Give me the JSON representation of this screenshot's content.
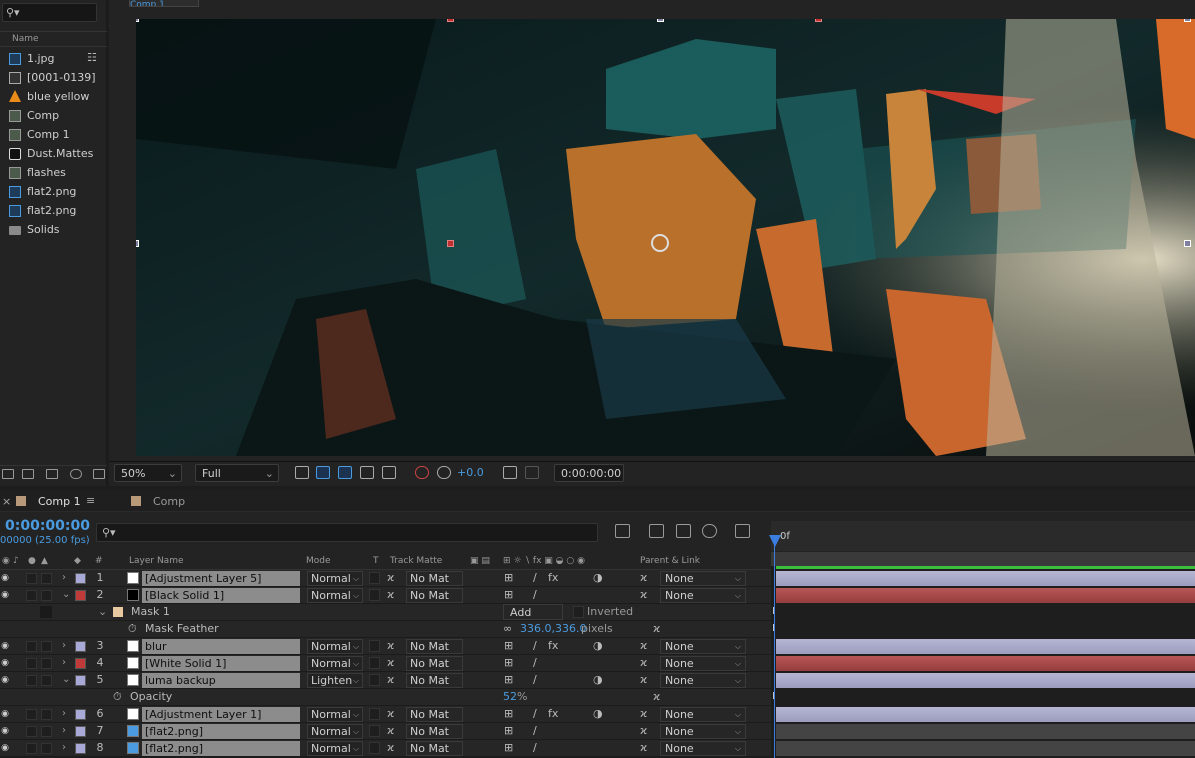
{
  "project": {
    "name_header": "Name",
    "items": [
      {
        "label": "1.jpg",
        "icon": "image-icon"
      },
      {
        "label": "[0001-0139]",
        "icon": "sequence-icon"
      },
      {
        "label": "blue yellow",
        "icon": "vlc-cone-icon"
      },
      {
        "label": "Comp",
        "icon": "composition-icon"
      },
      {
        "label": "Comp 1",
        "icon": "composition-icon"
      },
      {
        "label": "Dust.Mattes",
        "icon": "dust-icon"
      },
      {
        "label": "flashes",
        "icon": "composition-icon"
      },
      {
        "label": "flat2.png",
        "icon": "image-icon"
      },
      {
        "label": "flat2.png",
        "icon": "image-icon"
      },
      {
        "label": "Solids",
        "icon": "folder-icon"
      }
    ]
  },
  "viewer": {
    "top_tab": "Comp 1",
    "zoom": "50%",
    "resolution": "Full",
    "exposure": "+0.0",
    "timecode": "0:00:00:00"
  },
  "timeline": {
    "tabs": [
      {
        "label": "Comp 1",
        "active": true
      },
      {
        "label": "Comp",
        "active": false
      }
    ],
    "current_time": "0:00:00:00",
    "fps": "00000 (25.00 fps)",
    "ruler_label": "0f",
    "columns": {
      "number": "#",
      "layer_name": "Layer Name",
      "mode": "Mode",
      "t": "T",
      "track_matte": "Track Matte",
      "parent": "Parent & Link"
    },
    "rows": [
      {
        "kind": "layer",
        "num": "1",
        "name": "[Adjustment Layer 5]",
        "mode": "Normal",
        "matte": "No Mat",
        "parent": "None",
        "label_color": "#a9a9d8",
        "thumb": "#ffffff",
        "fx": true,
        "adj": true,
        "bar": "purple"
      },
      {
        "kind": "layer",
        "num": "2",
        "name": "[Black Solid 1]",
        "mode": "Normal",
        "matte": "No Mat",
        "parent": "None",
        "label_color": "#c03a3a",
        "thumb": "#000000",
        "fx": false,
        "adj": false,
        "bar": "red",
        "expanded": true
      },
      {
        "kind": "mask",
        "name": "Mask 1",
        "mode": "Add",
        "inverted": "Inverted"
      },
      {
        "kind": "prop",
        "name": "Mask Feather",
        "value": "336.0,336.0",
        "unit": "pixels"
      },
      {
        "kind": "layer",
        "num": "3",
        "name": "blur",
        "mode": "Normal",
        "matte": "No Mat",
        "parent": "None",
        "label_color": "#a9a9d8",
        "thumb": "#ffffff",
        "fx": true,
        "adj": true,
        "bar": "purple"
      },
      {
        "kind": "layer",
        "num": "4",
        "name": "[White Solid 1]",
        "mode": "Normal",
        "matte": "No Mat",
        "parent": "None",
        "label_color": "#c03a3a",
        "thumb": "#ffffff",
        "fx": false,
        "adj": false,
        "bar": "red"
      },
      {
        "kind": "layer",
        "num": "5",
        "name": "luma backup",
        "mode": "Lighten",
        "matte": "No Mat",
        "parent": "None",
        "label_color": "#a9a9d8",
        "thumb": "#ffffff",
        "fx": false,
        "adj": true,
        "bar": "purple",
        "expanded": true
      },
      {
        "kind": "prop",
        "name": "Opacity",
        "value": "52",
        "unit": "%"
      },
      {
        "kind": "layer",
        "num": "6",
        "name": "[Adjustment Layer 1]",
        "mode": "Normal",
        "matte": "No Mat",
        "parent": "None",
        "label_color": "#a9a9d8",
        "thumb": "#ffffff",
        "fx": true,
        "adj": true,
        "bar": "purple"
      },
      {
        "kind": "layer",
        "num": "7",
        "name": "[flat2.png]",
        "mode": "Normal",
        "matte": "No Mat",
        "parent": "None",
        "label_color": "#a9a9d8",
        "thumb": "#4a9be0",
        "fx": false,
        "adj": false,
        "bar": "gray"
      },
      {
        "kind": "layer",
        "num": "8",
        "name": "[flat2.png]",
        "mode": "Normal",
        "matte": "No Mat",
        "parent": "None",
        "label_color": "#a9a9d8",
        "thumb": "#4a9be0",
        "fx": false,
        "adj": false,
        "bar": "gray"
      }
    ]
  },
  "colors": {
    "accent": "#4a9be0",
    "playhead": "#3c7de0"
  }
}
